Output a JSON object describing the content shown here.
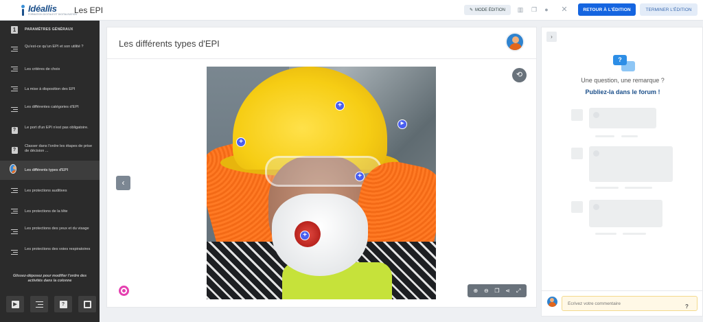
{
  "app": {
    "logo_name": "Idéallis",
    "logo_tagline": "FORMATION DIGITALE ET DIGITALISATION",
    "title": "Les EPI"
  },
  "toolbar": {
    "mode_label": "MODE ÉDITION",
    "retour_label": "RETOUR À L'ÉDITION",
    "terminer_label": "TERMINER L'ÉDITION"
  },
  "sidebar": {
    "items": [
      {
        "label": "PARAMÈTRES GÉNÉRAUX",
        "icon": "number-one-icon",
        "number": "1"
      },
      {
        "label": "Qu'est-ce qu'un EPI et son utilité ?",
        "icon": "text-lines-icon"
      },
      {
        "label": "Les critères de choix",
        "icon": "text-lines-icon"
      },
      {
        "label": "La mise à disposition des EPI",
        "icon": "text-lines-icon"
      },
      {
        "label": "Les différentes catégories d'EPI",
        "icon": "text-lines-icon"
      },
      {
        "label": "Le port d'un EPI n'est pas obligatoire.",
        "icon": "question-icon"
      },
      {
        "label": "Classer dans l'ordre les étapes de prise de décision ...",
        "icon": "question-icon"
      },
      {
        "label": "Les différents types d'EPI",
        "icon": "avatar-icon",
        "active": true
      },
      {
        "label": "Les protections auditives",
        "icon": "text-lines-icon"
      },
      {
        "label": "Les protections de la tête",
        "icon": "text-lines-icon"
      },
      {
        "label": "Les protections des yeux et du visage",
        "icon": "text-lines-icon"
      },
      {
        "label": "Les protections des voies respiratoires",
        "icon": "text-lines-icon"
      }
    ],
    "hint": "Glissez-déposez pour modifier l'ordre des activités dans la colonne",
    "tools": [
      "video-icon",
      "text-lines-icon",
      "question-icon",
      "expand-icon"
    ]
  },
  "main": {
    "title": "Les différents types d'EPI",
    "zoom_tools": [
      "zoom-in-icon",
      "zoom-out-icon",
      "layers-icon",
      "share-icon",
      "fullscreen-icon"
    ]
  },
  "forum": {
    "question": "Une question, une remarque ?",
    "cta": "Publiez-la dans le forum !",
    "comment_placeholder": "Écrivez votre commentaire",
    "help": "?"
  },
  "colors": {
    "primary": "#1565e0",
    "sidebar_bg": "#2b2b2b",
    "hotspot": "#4a5ff0",
    "brand_pink": "#e53fb0"
  }
}
